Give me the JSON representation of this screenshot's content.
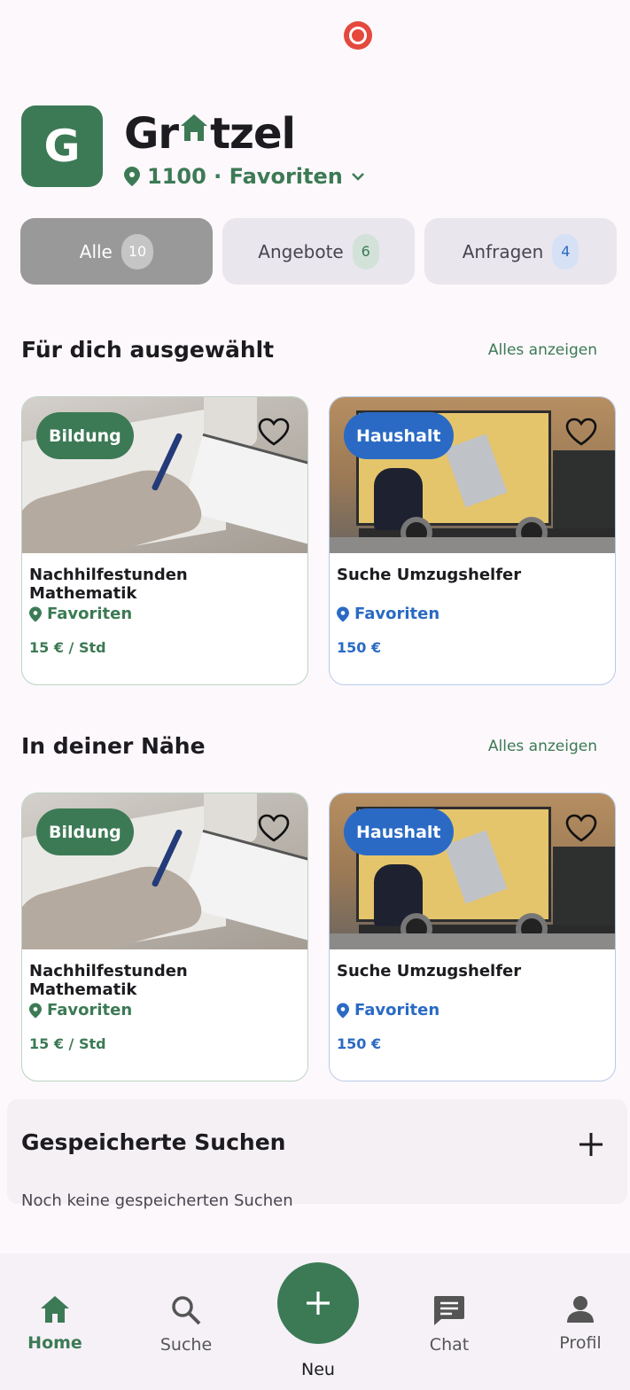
{
  "brand": {
    "logo_letter": "G",
    "name_prefix": "Gr",
    "name_suffix": "tzel",
    "location": "1100 · Favoriten"
  },
  "filters": [
    {
      "label": "Alle",
      "count": "10"
    },
    {
      "label": "Angebote",
      "count": "6"
    },
    {
      "label": "Anfragen",
      "count": "4"
    }
  ],
  "sections": [
    {
      "title": "Für dich ausgewählt",
      "link": "Alles anzeigen",
      "cards": [
        {
          "category": "Bildung",
          "title": "Nachhilfestunden Mathematik",
          "location": "Favoriten",
          "price": "15 € / Std"
        },
        {
          "category": "Haushalt",
          "title": "Suche Umzugshelfer",
          "location": "Favoriten",
          "price": "150 €"
        }
      ]
    },
    {
      "title": "In deiner Nähe",
      "link": "Alles anzeigen",
      "cards": [
        {
          "category": "Bildung",
          "title": "Nachhilfestunden Mathematik",
          "location": "Favoriten",
          "price": "15 € / Std"
        },
        {
          "category": "Haushalt",
          "title": "Suche Umzugshelfer",
          "location": "Favoriten",
          "price": "150 €"
        }
      ]
    }
  ],
  "saved_searches": {
    "title": "Gespeicherte Suchen",
    "empty_text": "Noch keine gespeicherten Suchen"
  },
  "nav": {
    "home": "Home",
    "search": "Suche",
    "new": "Neu",
    "chat": "Chat",
    "profile": "Profil"
  },
  "colors": {
    "primary_green": "#3c7a55",
    "accent_blue": "#2a6ac4",
    "record_red": "#e5483c"
  }
}
